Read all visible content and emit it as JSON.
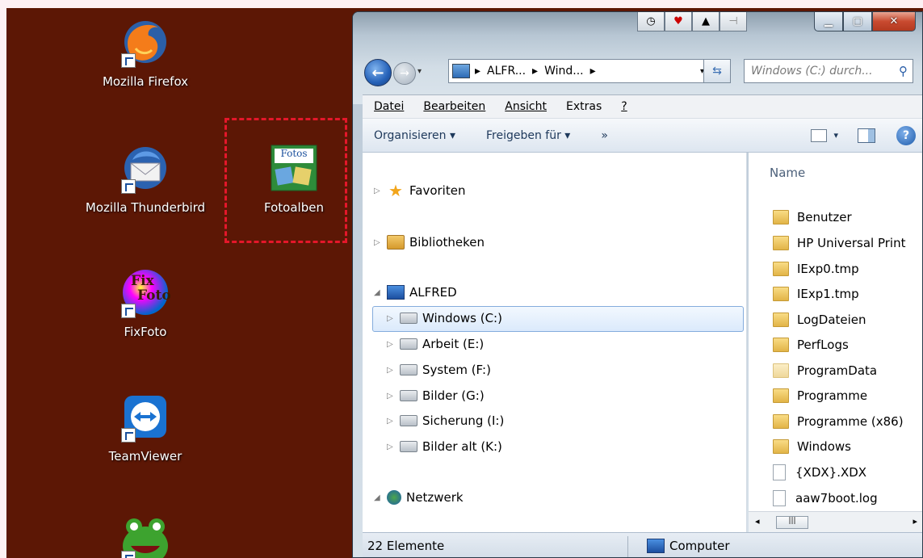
{
  "desktop": {
    "icons": [
      {
        "label": "Mozilla Firefox",
        "icon": "firefox-icon"
      },
      {
        "label": "Mozilla Thunderbird",
        "icon": "thunderbird-icon"
      },
      {
        "label": "Fotoalben",
        "icon": "fotoalben-icon",
        "badge": "Fotos"
      },
      {
        "label": "FixFoto",
        "icon": "fixfoto-icon",
        "badge_top": "Fix",
        "badge_bottom": "Foto"
      },
      {
        "label": "TeamViewer",
        "icon": "teamviewer-icon"
      },
      {
        "label": "",
        "icon": "frog-icon"
      }
    ],
    "background_color": "#5c1705"
  },
  "window": {
    "address": {
      "crumbs": [
        "ALFR...",
        "Wind..."
      ],
      "separator": "▸"
    },
    "search_placeholder": "Windows (C:) durch...",
    "menu": {
      "datei": "Datei",
      "bearbeiten": "Bearbeiten",
      "ansicht": "Ansicht",
      "extras": "Extras",
      "help": "?"
    },
    "toolbar": {
      "organize": "Organisieren ▾",
      "share": "Freigeben für ▾",
      "more": "»"
    },
    "nav": {
      "favoriten": "Favoriten",
      "bibliotheken": "Bibliotheken",
      "computer": "ALFRED",
      "drives": [
        "Windows (C:)",
        "Arbeit (E:)",
        "System (F:)",
        "Bilder (G:)",
        "Sicherung (I:)",
        "Bilder alt (K:)"
      ],
      "netzwerk": "Netzwerk"
    },
    "files": {
      "column_name": "Name",
      "items": [
        "Benutzer",
        "HP Universal Print",
        "IExp0.tmp",
        "IExp1.tmp",
        "LogDateien",
        "PerfLogs",
        "ProgramData",
        "Programme",
        "Programme (x86)",
        "Windows",
        "{XDX}.XDX",
        "aaw7boot.log"
      ]
    },
    "status": {
      "count": "22 Elemente",
      "location": "Computer"
    },
    "accent": "#2561b8",
    "selection_color": "#84acdd"
  },
  "highlight_color": "#e4172a"
}
